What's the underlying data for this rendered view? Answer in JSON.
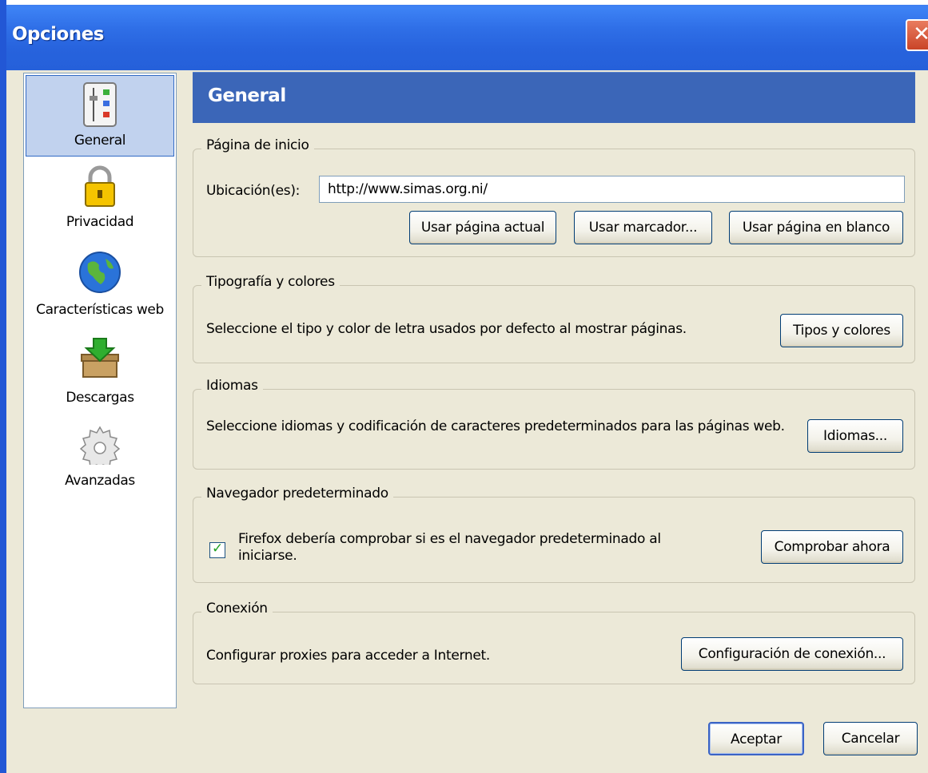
{
  "window": {
    "title": "Opciones",
    "close_icon": "close-icon"
  },
  "sidebar": {
    "items": [
      {
        "label": "General",
        "icon": "sliders-icon",
        "selected": true
      },
      {
        "label": "Privacidad",
        "icon": "padlock-icon",
        "selected": false
      },
      {
        "label": "Características web",
        "icon": "globe-icon",
        "selected": false
      },
      {
        "label": "Descargas",
        "icon": "download-box-icon",
        "selected": false
      },
      {
        "label": "Avanzadas",
        "icon": "gear-icon",
        "selected": false
      }
    ]
  },
  "header": {
    "title": "General"
  },
  "homepage": {
    "legend": "Página de inicio",
    "location_label": "Ubicación(es):",
    "location_value": "http://www.simas.org.ni/",
    "use_current_button": "Usar página actual",
    "use_bookmark_button": "Usar marcador...",
    "use_blank_button": "Usar página en blanco"
  },
  "fonts": {
    "legend": "Tipografía y colores",
    "description": "Seleccione el tipo y color de letra usados por defecto al mostrar páginas.",
    "button": "Tipos y colores"
  },
  "languages": {
    "legend": "Idiomas",
    "description": "Seleccione idiomas y codificación de caracteres predeterminados para las páginas web.",
    "button": "Idiomas..."
  },
  "default_browser": {
    "legend": "Navegador predeterminado",
    "checkbox_label": "Firefox debería comprobar si es el navegador predeterminado al iniciarse.",
    "checked": true,
    "button": "Comprobar ahora"
  },
  "connection": {
    "legend": "Conexión",
    "description": "Configurar proxies para acceder a Internet.",
    "button": "Configuración de conexión..."
  },
  "footer": {
    "accept_button": "Aceptar",
    "cancel_button": "Cancelar"
  },
  "colors": {
    "titlebar": "#2763dd",
    "header": "#3b66b8",
    "dialog": "#ece9d8",
    "selected_item": "#c1d2ee"
  }
}
